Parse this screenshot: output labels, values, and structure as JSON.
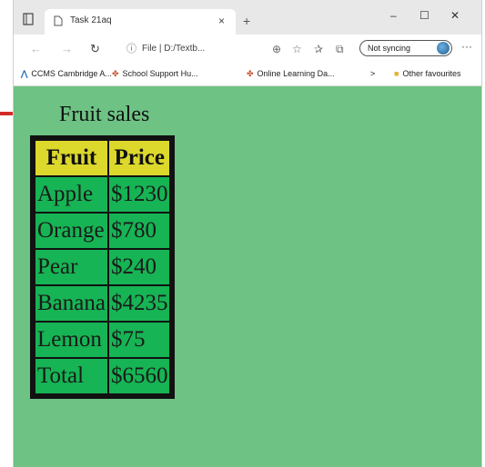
{
  "browser": {
    "tab_title": "Task 21aq",
    "tab_close": "×",
    "new_tab": "+",
    "window_controls": [
      "–",
      "☐",
      "✕"
    ],
    "address_text": "File | D:/Textb...",
    "sync_label": "Not syncing",
    "more_label": "···",
    "favourites": [
      {
        "label": "CCMS Cambridge A...",
        "icon": "cambridge-icon"
      },
      {
        "label": "School Support Hu...",
        "icon": "puzzle-icon"
      },
      {
        "label": "Online Learning Da...",
        "icon": "puzzle-icon"
      }
    ],
    "favourites_overflow": ">",
    "other_favourites": "Other favourites"
  },
  "page": {
    "heading": "Fruit sales",
    "table": {
      "headers": [
        "Fruit",
        "Price"
      ],
      "rows": [
        [
          "Apple",
          "$1230"
        ],
        [
          "Orange",
          "$780"
        ],
        [
          "Pear",
          "$240"
        ],
        [
          "Banana",
          "$4235"
        ],
        [
          "Lemon",
          "$75"
        ],
        [
          "Total",
          "$6560"
        ]
      ]
    }
  },
  "colors": {
    "page_background": "#6dc284",
    "header_background": "#dcd82c",
    "cell_background": "#16b454",
    "table_border": "#111111",
    "arrow": "#d42a2a"
  }
}
